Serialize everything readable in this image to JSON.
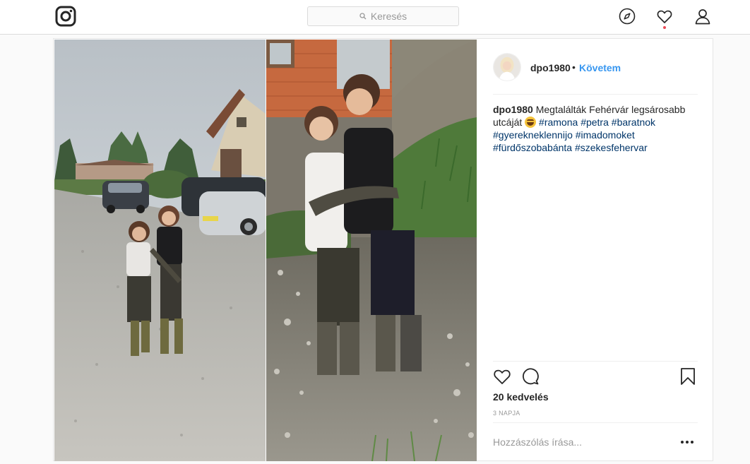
{
  "search": {
    "placeholder": "Keresés"
  },
  "nav": {
    "logo_icon": "instagram-logo-icon",
    "explore_icon": "compass-icon",
    "activity_icon": "heart-icon",
    "profile_icon": "user-icon",
    "has_notification": true
  },
  "post": {
    "username": "dpo1980",
    "separator": "•",
    "follow_label": "Követem",
    "caption": {
      "username": "dpo1980",
      "text": "Megtalálták Fehérvár legsárosabb utcáját",
      "emoji": "grinning-squinting-face",
      "hashtags": [
        "#ramona",
        "#petra",
        "#baratnok",
        "#gyerekneklennijo",
        "#imadomoket",
        "#fürdőszobabánta",
        "#szekesfehervar"
      ]
    },
    "likes_text": "20 kedvelés",
    "time_ago": "3 NAPJA",
    "comment_placeholder": "Hozzászólás írása...",
    "more_label": "•••"
  },
  "colors": {
    "link": "#3897f0",
    "hashtag": "#003569",
    "notification": "#ed4956",
    "border": "#dbdbdb"
  }
}
